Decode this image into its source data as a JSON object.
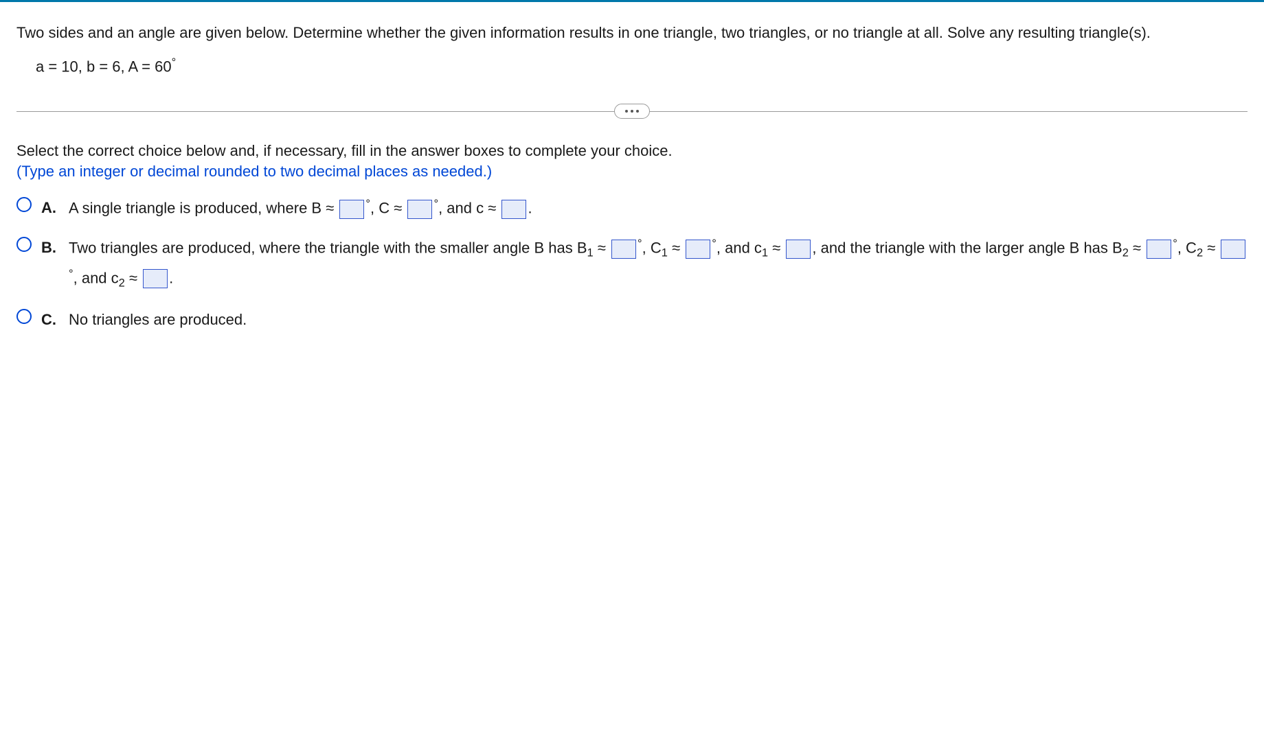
{
  "question": {
    "prompt": "Two sides and an angle are given below. Determine whether the given information results in one triangle, two triangles, or no triangle at all. Solve any resulting triangle(s).",
    "given_prefix": "a = 10, b = 6, A = 60",
    "degree_symbol": "°"
  },
  "divider": {
    "aria": "expand"
  },
  "answers": {
    "instruction": "Select the correct choice below and, if necessary, fill in the answer boxes to complete your choice.",
    "hint": "(Type an integer or decimal rounded to two decimal places as needed.)",
    "choices": {
      "a": {
        "label": "A.",
        "t1": "A single triangle is produced, where B ≈",
        "t2": ", C ≈",
        "t3": ", and c ≈",
        "period": "."
      },
      "b": {
        "label": "B.",
        "t1": "Two triangles are produced, where the triangle with the smaller angle B has B",
        "sub1": "1",
        "approx": " ≈",
        "t2": ", C",
        "t3": ", and c",
        "t4": ", and the triangle with the larger angle B has B",
        "sub2": "2",
        "period": "."
      },
      "c": {
        "label": "C.",
        "text": "No triangles are produced."
      }
    },
    "degree_symbol": "°"
  }
}
